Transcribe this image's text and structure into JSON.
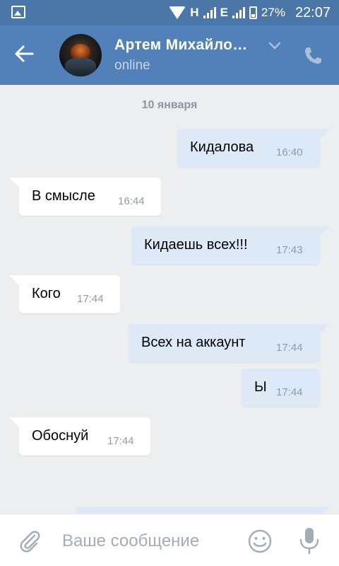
{
  "status_bar": {
    "network_1": "H",
    "network_2": "E",
    "battery": "27%",
    "time": "22:07"
  },
  "header": {
    "name": "Артем Михайло…",
    "status": "online"
  },
  "chat": {
    "date": "10 января",
    "messages": [
      {
        "dir": "out",
        "text": "Кидалова",
        "time": "16:40"
      },
      {
        "dir": "in",
        "text": "В смысле",
        "time": "16:44"
      },
      {
        "dir": "out",
        "text": "Кидаешь всех!!!",
        "time": "17:43"
      },
      {
        "dir": "in",
        "text": "Кого",
        "time": "17:44"
      },
      {
        "dir": "out",
        "text": "Всех на аккаунт",
        "time": "17:44"
      },
      {
        "dir": "out",
        "text": "Ы",
        "time": "17:44"
      },
      {
        "dir": "in",
        "text": "Обоснуй",
        "time": "17:44"
      }
    ]
  },
  "composer": {
    "placeholder": "Ваше сообщение"
  },
  "colors": {
    "header": "#5181b8",
    "status_bar": "#4a76a8",
    "background": "#edeef0",
    "outgoing_bubble": "#dde9f7",
    "incoming_bubble": "#ffffff"
  }
}
